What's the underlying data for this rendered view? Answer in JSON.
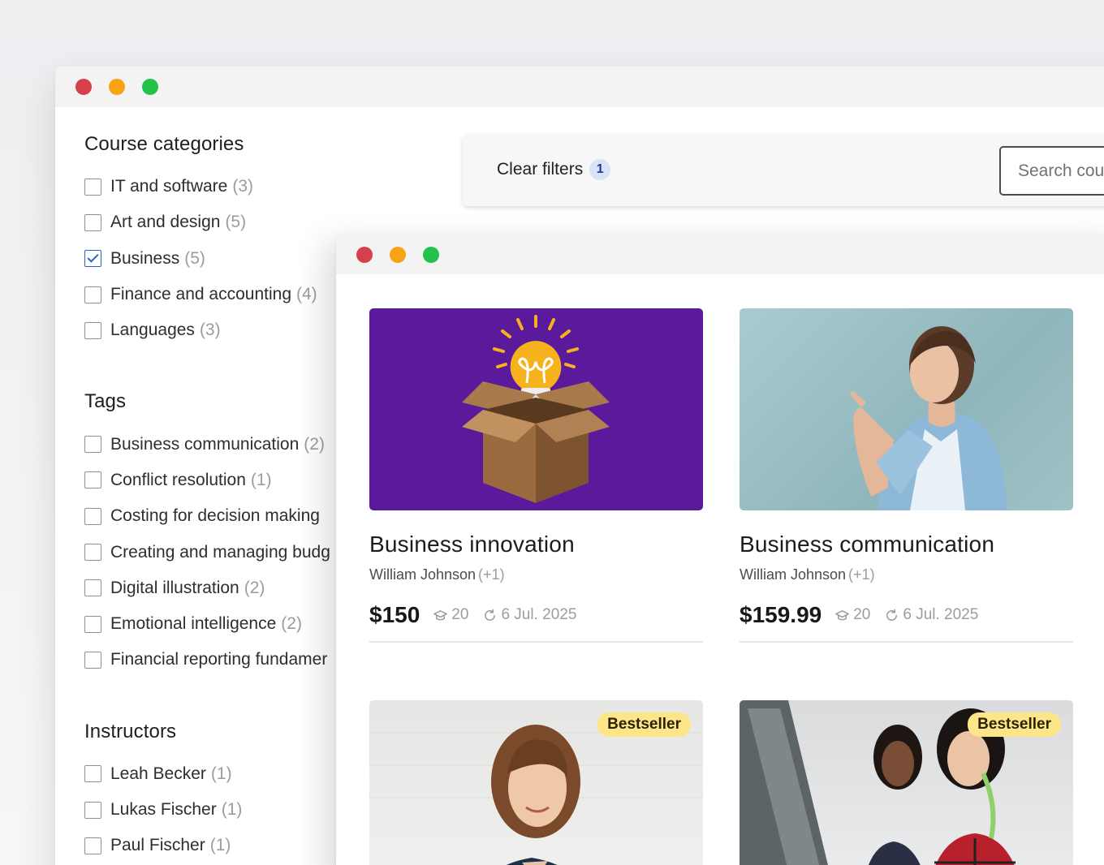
{
  "back_window": {
    "filters": {
      "categories": {
        "title": "Course categories",
        "items": [
          {
            "label": "IT and software",
            "count": "(3)",
            "checked": false
          },
          {
            "label": "Art and design",
            "count": "(5)",
            "checked": false
          },
          {
            "label": "Business",
            "count": "(5)",
            "checked": true
          },
          {
            "label": "Finance and accounting",
            "count": "(4)",
            "checked": false
          },
          {
            "label": "Languages",
            "count": "(3)",
            "checked": false
          }
        ]
      },
      "tags": {
        "title": "Tags",
        "items": [
          {
            "label": "Business communication",
            "count": "(2)",
            "checked": false
          },
          {
            "label": "Conflict resolution",
            "count": "(1)",
            "checked": false
          },
          {
            "label": "Costing for decision making",
            "count": "",
            "checked": false
          },
          {
            "label": "Creating and managing budg",
            "count": "",
            "checked": false
          },
          {
            "label": "Digital illustration",
            "count": "(2)",
            "checked": false
          },
          {
            "label": "Emotional intelligence",
            "count": "(2)",
            "checked": false
          },
          {
            "label": "Financial reporting fundamer",
            "count": "",
            "checked": false
          }
        ]
      },
      "instructors": {
        "title": "Instructors",
        "items": [
          {
            "label": "Leah Becker",
            "count": "(1)",
            "checked": false
          },
          {
            "label": "Lukas Fischer",
            "count": "(1)",
            "checked": false
          },
          {
            "label": "Paul Fischer",
            "count": "(1)",
            "checked": false
          }
        ]
      }
    },
    "toolbar": {
      "clear_label": "Clear filters",
      "clear_count": "1",
      "search_placeholder": "Search courses"
    }
  },
  "front_window": {
    "courses": [
      {
        "title": "Business innovation",
        "author": "William Johnson",
        "author_extra": "(+1)",
        "price": "$150",
        "students": "20",
        "date": "6 Jul. 2025",
        "image": "lightbulb-box-illustration",
        "badge": ""
      },
      {
        "title": "Business communication",
        "author": "William Johnson",
        "author_extra": "(+1)",
        "price": "$159.99",
        "students": "20",
        "date": "6 Jul. 2025",
        "image": "woman-pointing-photo",
        "badge": ""
      },
      {
        "title": "",
        "image": "smiling-woman-photo",
        "badge": "Bestseller"
      },
      {
        "title": "",
        "image": "two-women-at-computer-photo",
        "badge": "Bestseller"
      }
    ]
  },
  "colors": {
    "accent_blue": "#2b64c8",
    "bestseller_bg": "#fde68a",
    "traffic_red": "#d6404b",
    "traffic_orange": "#f6a316",
    "traffic_green": "#23c24b",
    "innovation_bg": "#5b1a9c"
  }
}
